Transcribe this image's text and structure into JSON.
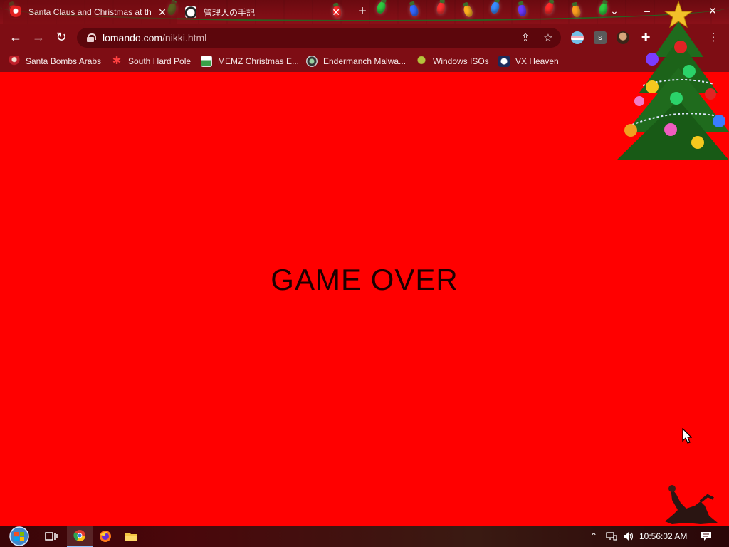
{
  "browser": {
    "tabs": [
      {
        "title": "Santa Claus and Christmas at the",
        "active": true,
        "favicon": "santa-icon"
      },
      {
        "title": "管理人の手記",
        "active": false,
        "favicon": "panda-icon"
      }
    ],
    "url": {
      "host": "lomando.com",
      "path": "/nikki.html"
    },
    "bookmarks": [
      {
        "label": "Santa Bombs Arabs",
        "icon": "santa-icon"
      },
      {
        "label": "South Hard Pole",
        "icon": "snowflake-icon"
      },
      {
        "label": "MEMZ Christmas E...",
        "icon": "memz-icon"
      },
      {
        "label": "Endermanch Malwa...",
        "icon": "enderman-icon"
      },
      {
        "label": "Windows ISOs",
        "icon": "bird-icon"
      },
      {
        "label": "VX Heaven",
        "icon": "vx-icon"
      }
    ]
  },
  "page": {
    "message": "GAME OVER",
    "background": "#ff0000"
  },
  "taskbar": {
    "clock": "10:56:02 AM",
    "apps": [
      "start-orb-icon",
      "task-view-icon",
      "chrome-icon",
      "firefox-icon",
      "file-explorer-icon"
    ]
  },
  "colors": {
    "chrome_bg": "#7e0d14",
    "omnibox_bg": "#5c060c",
    "content_bg": "#ff0000"
  }
}
